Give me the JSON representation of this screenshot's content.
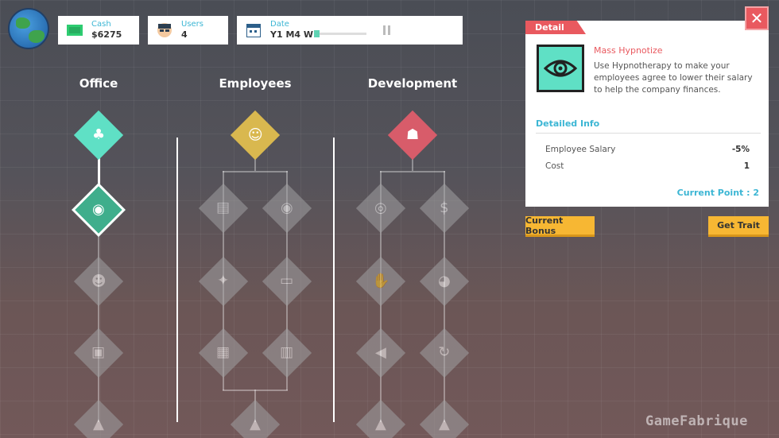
{
  "stats": {
    "cash": {
      "label": "Cash",
      "value": "$6275",
      "icon": "cash-icon"
    },
    "users": {
      "label": "Users",
      "value": "4",
      "icon": "user-face-icon"
    },
    "date": {
      "label": "Date",
      "value": "Y1 M4 W",
      "progress": 0.05,
      "icon": "calendar-icon"
    }
  },
  "columns": {
    "office": {
      "title": "Office"
    },
    "employees": {
      "title": "Employees"
    },
    "development": {
      "title": "Development"
    }
  },
  "detail": {
    "tab_label": "Detail",
    "trait_name": "Mass Hypnotize",
    "description": "Use Hypnotherapy to make your employees agree to lower their salary to help the company finances.",
    "detailed_info_title": "Detailed Info",
    "rows": [
      {
        "label": "Employee Salary",
        "value": "-5%"
      },
      {
        "label": "Cost",
        "value": "1"
      }
    ],
    "current_point": "Current Point : 2",
    "close_label": "✕"
  },
  "buttons": {
    "current_bonus": "Current Bonus",
    "get_trait": "Get Trait"
  },
  "watermark": "GameFabrique",
  "colors": {
    "accent_teal": "#5fe0c5",
    "accent_red": "#e9595f",
    "accent_yellow": "#f7b733",
    "accent_blue": "#3cb6d4"
  }
}
